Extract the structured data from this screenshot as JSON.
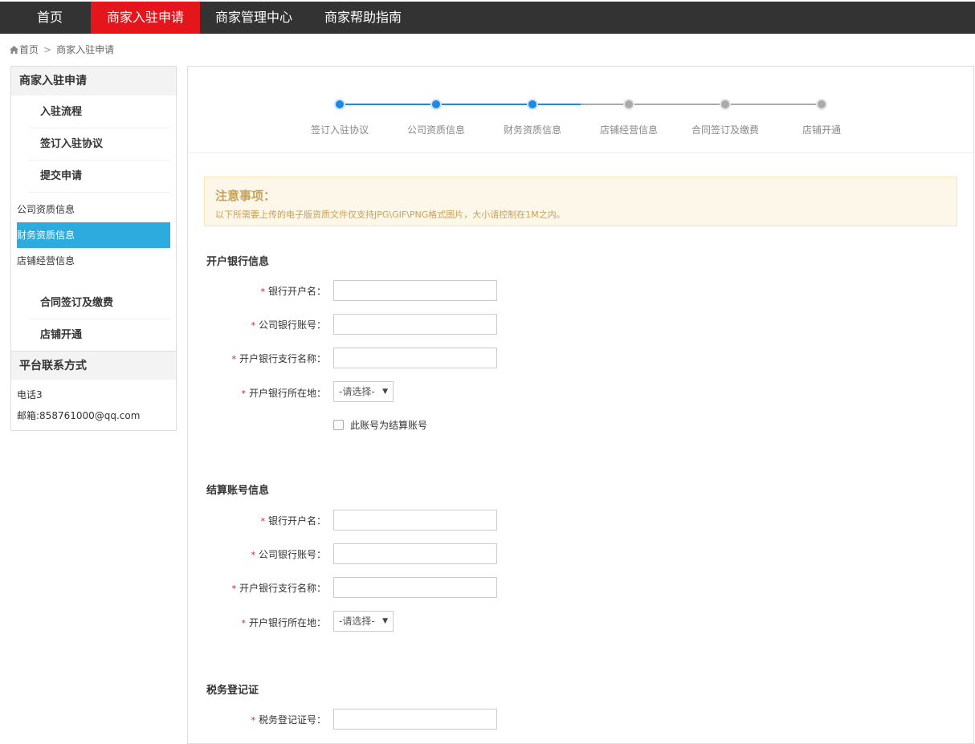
{
  "nav": {
    "items": [
      "首页",
      "商家入驻申请",
      "商家管理中心",
      "商家帮助指南"
    ],
    "active_index": 1,
    "active_color": "#e5161b"
  },
  "breadcrumb": {
    "home_icon": "home-icon",
    "home": "首页",
    "separator": ">",
    "current": "商家入驻申请"
  },
  "sidebar": {
    "header": "商家入驻申请",
    "sub_items": [
      "入驻流程",
      "签订入驻协议",
      "提交申请"
    ],
    "plain_items": [
      "公司资质信息",
      "财务资质信息",
      "店铺经营信息"
    ],
    "active_plain_index": 1,
    "active_color": "#2dabdf",
    "sub_items2": [
      "合同签订及缴费",
      "店铺开通"
    ],
    "contact_header": "平台联系方式",
    "phone": "电话3",
    "email": "邮箱:858761000@qq.com"
  },
  "steps": {
    "labels": [
      "签订入驻协议",
      "公司资质信息",
      "财务资质信息",
      "店铺经营信息",
      "合同签订及缴费",
      "店铺开通"
    ],
    "current_index": 2,
    "done_color": "#1e88e5",
    "todo_color": "#aaaaaa"
  },
  "notice": {
    "title": "注意事项：",
    "text": "以下所需要上传的电子版资质文件仅支持JPG\\GIF\\PNG格式图片，大小请控制在1M之内。"
  },
  "bank_section": {
    "title": "开户银行信息",
    "fields": {
      "account_name": "银行开户名：",
      "account_no": "公司银行账号：",
      "branch": "开户银行支行名称：",
      "location": "开户银行所在地："
    },
    "select_value": "-请选择-",
    "checkbox_label": "此账号为结算账号"
  },
  "settle_section": {
    "title": "结算账号信息",
    "fields": {
      "account_name": "银行开户名：",
      "account_no": "公司银行账号：",
      "branch": "开户银行支行名称：",
      "location": "开户银行所在地："
    },
    "select_value": "-请选择-"
  },
  "tax_section": {
    "title": "税务登记证",
    "fields": {
      "tax_no": "税务登记证号："
    }
  },
  "required_mark": "*"
}
